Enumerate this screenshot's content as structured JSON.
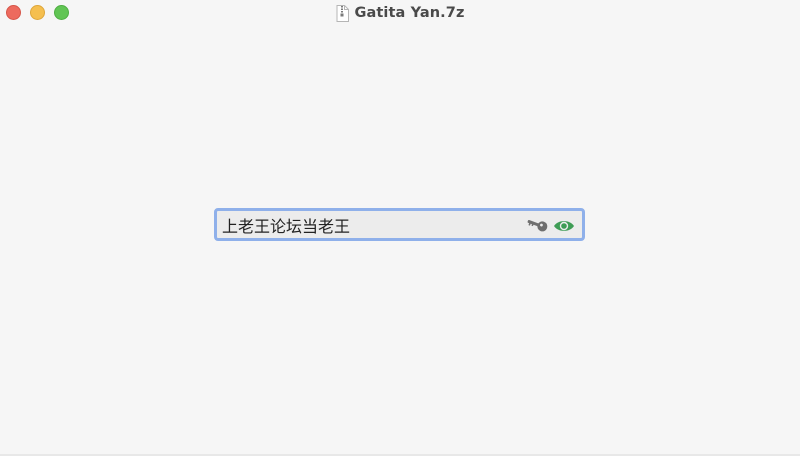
{
  "window": {
    "title": "Gatita Yan.7z"
  },
  "password_field": {
    "value": "上老王论坛当老王"
  },
  "icons": {
    "title_icon": "archive-file-icon",
    "key_icon": "key-icon",
    "reveal_icon": "eye-icon"
  },
  "colors": {
    "close": "#ed6a5e",
    "minimize": "#f5bf4f",
    "zoom": "#61c554",
    "focus_ring": "#8fb0ea",
    "eye": "#3e9c55",
    "key": "#707070"
  }
}
